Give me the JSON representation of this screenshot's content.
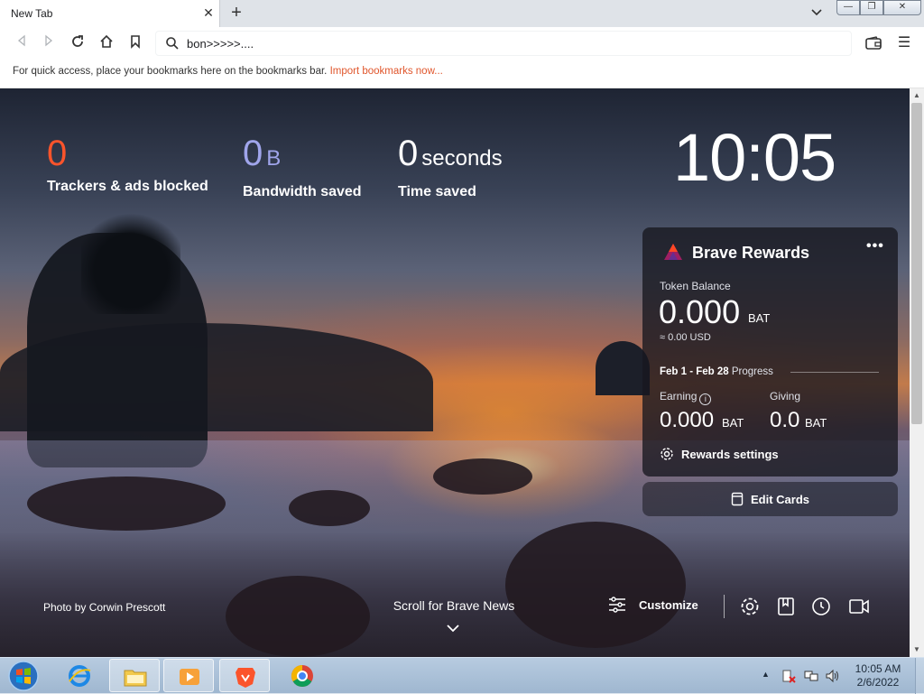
{
  "tab": {
    "title": "New Tab",
    "close": "✕",
    "new_tab": "+"
  },
  "window": {
    "minimize": "—",
    "maximize": "❐",
    "close": "✕"
  },
  "toolbar": {
    "address": "bon>>>>>...."
  },
  "bookmarks_bar": {
    "message": "For quick access, place your bookmarks here on the bookmarks bar.",
    "link": "Import bookmarks now..."
  },
  "stats": {
    "trackers": {
      "value": "0",
      "label": "Trackers & ads blocked"
    },
    "bandwidth": {
      "value": "0",
      "unit": "B",
      "label": "Bandwidth saved"
    },
    "time": {
      "value": "0",
      "unit": "seconds",
      "label": "Time saved"
    }
  },
  "clock": "10:05",
  "rewards": {
    "title": "Brave Rewards",
    "more": "•••",
    "token_label": "Token Balance",
    "balance": "0.000",
    "balance_unit": "BAT",
    "usd": "≈ 0.00 USD",
    "period_dates": "Feb 1 - Feb 28",
    "period_suffix": "Progress",
    "earning_label": "Earning",
    "earning_value": "0.000",
    "earning_unit": "BAT",
    "giving_label": "Giving",
    "giving_value": "0.0",
    "giving_unit": "BAT",
    "settings_label": "Rewards settings"
  },
  "edit_cards": "Edit Cards",
  "photo_credit": "Photo by Corwin Prescott",
  "news": "Scroll for Brave News",
  "customize": "Customize",
  "taskbar": {
    "time": "10:05 AM",
    "date": "2/6/2022"
  },
  "colors": {
    "brave_orange": "#fb542b",
    "bandwidth_purple": "#a0a5eb",
    "bookmark_link": "#e0562c"
  }
}
